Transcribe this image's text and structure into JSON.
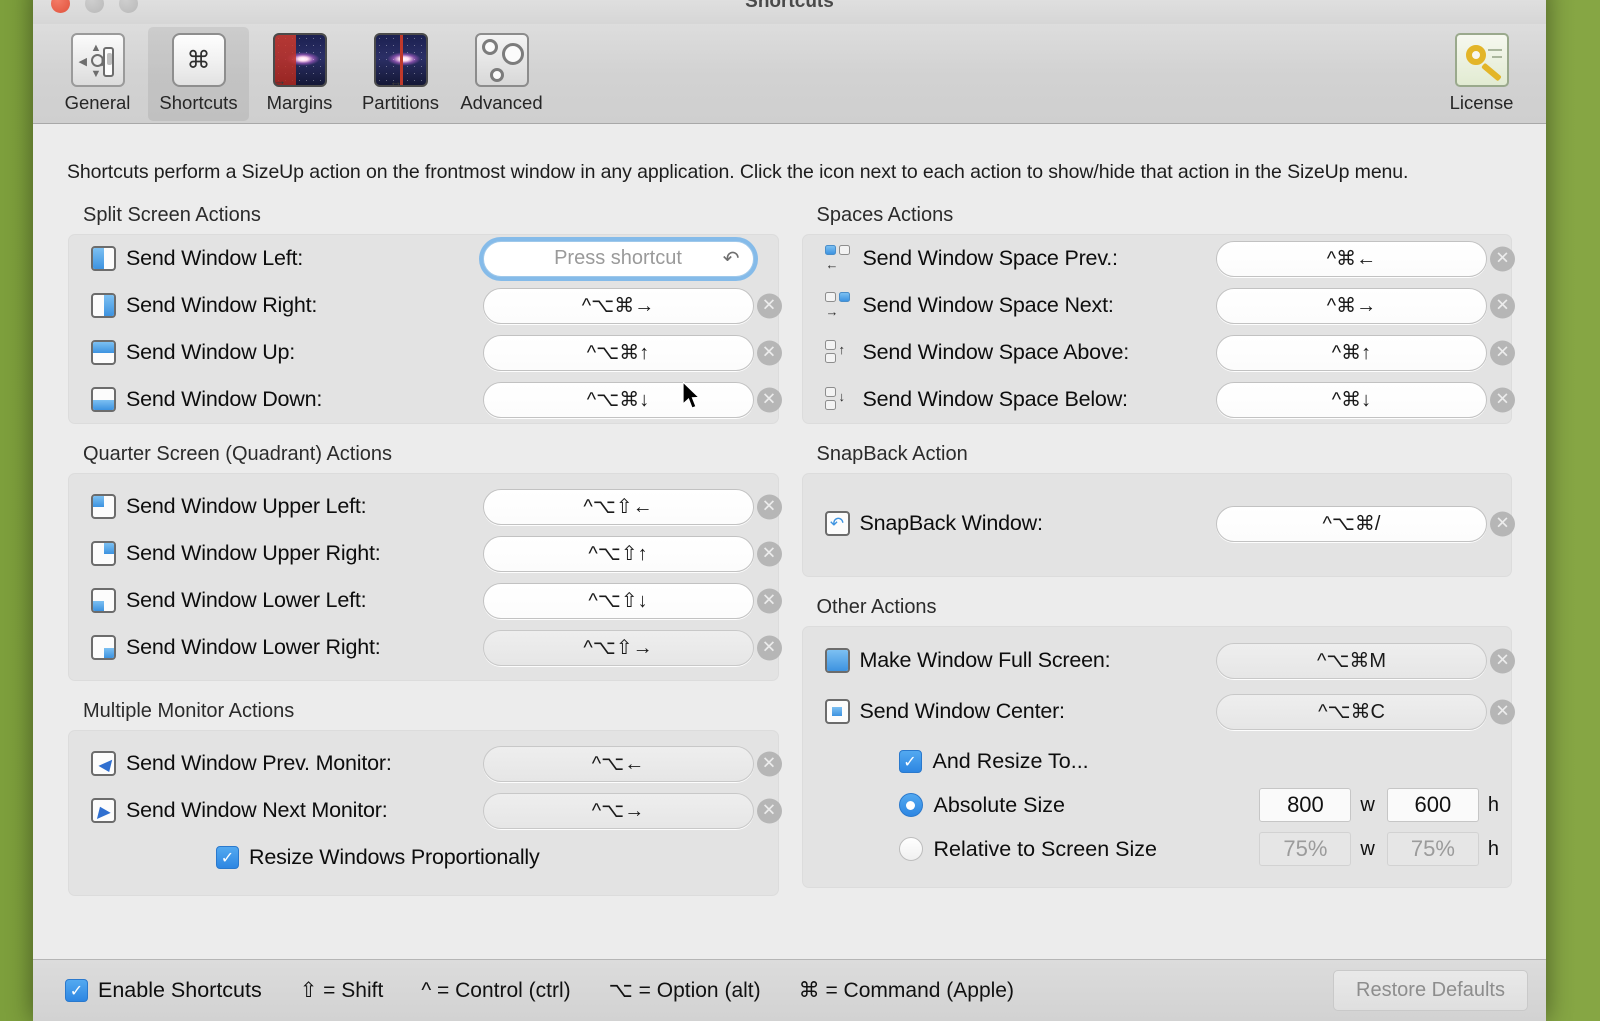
{
  "window": {
    "title": "Shortcuts"
  },
  "toolbar": {
    "items": [
      {
        "label": "General",
        "icon": "general-icon"
      },
      {
        "label": "Shortcuts",
        "icon": "command-icon"
      },
      {
        "label": "Margins",
        "icon": "margins-icon"
      },
      {
        "label": "Partitions",
        "icon": "partitions-icon"
      },
      {
        "label": "Advanced",
        "icon": "gears-icon"
      }
    ],
    "selected": "Shortcuts",
    "license": {
      "label": "License",
      "icon": "key-certificate-icon"
    }
  },
  "intro": "Shortcuts perform a SizeUp action on the frontmost window in any application. Click the icon next to each action to show/hide that action in the SizeUp menu.",
  "groups": {
    "split_screen": {
      "title": "Split Screen Actions",
      "rows": [
        {
          "label": "Send Window Left:",
          "shortcut": "",
          "placeholder": "Press shortcut",
          "focused": true,
          "icon": "half-left-icon"
        },
        {
          "label": "Send Window Right:",
          "shortcut": "^⌥⌘→",
          "focused": false,
          "icon": "half-right-icon"
        },
        {
          "label": "Send Window Up:",
          "shortcut": "^⌥⌘↑",
          "focused": false,
          "icon": "half-top-icon"
        },
        {
          "label": "Send Window Down:",
          "shortcut": "^⌥⌘↓",
          "focused": false,
          "icon": "half-bottom-icon"
        }
      ]
    },
    "quadrant": {
      "title": "Quarter Screen (Quadrant) Actions",
      "rows": [
        {
          "label": "Send Window Upper Left:",
          "shortcut": "^⌥⇧←",
          "icon": "quad-upper-left-icon"
        },
        {
          "label": "Send Window Upper Right:",
          "shortcut": "^⌥⇧↑",
          "icon": "quad-upper-right-icon"
        },
        {
          "label": "Send Window Lower Left:",
          "shortcut": "^⌥⇧↓",
          "icon": "quad-lower-left-icon"
        },
        {
          "label": "Send Window Lower Right:",
          "shortcut": "^⌥⇧→",
          "icon": "quad-lower-right-icon"
        }
      ]
    },
    "multi_monitor": {
      "title": "Multiple Monitor Actions",
      "rows": [
        {
          "label": "Send Window Prev. Monitor:",
          "shortcut": "^⌥←",
          "icon": "monitor-prev-icon"
        },
        {
          "label": "Send Window Next Monitor:",
          "shortcut": "^⌥→",
          "icon": "monitor-next-icon"
        }
      ],
      "checkbox": {
        "label": "Resize Windows Proportionally",
        "checked": true
      }
    },
    "spaces": {
      "title": "Spaces Actions",
      "rows": [
        {
          "label": "Send Window Space Prev.:",
          "shortcut": "^⌘←",
          "icon": "space-prev-icon"
        },
        {
          "label": "Send Window Space Next:",
          "shortcut": "^⌘→",
          "icon": "space-next-icon"
        },
        {
          "label": "Send Window Space Above:",
          "shortcut": "^⌘↑",
          "icon": "space-above-icon"
        },
        {
          "label": "Send Window Space Below:",
          "shortcut": "^⌘↓",
          "icon": "space-below-icon"
        }
      ]
    },
    "snapback": {
      "title": "SnapBack Action",
      "rows": [
        {
          "label": "SnapBack Window:",
          "shortcut": "^⌥⌘/",
          "icon": "snapback-icon"
        }
      ]
    },
    "other": {
      "title": "Other Actions",
      "rows": [
        {
          "label": "Make Window Full Screen:",
          "shortcut": "^⌥⌘M",
          "icon": "full-screen-icon"
        },
        {
          "label": "Send Window Center:",
          "shortcut": "^⌥⌘C",
          "icon": "center-icon"
        }
      ],
      "resize_checkbox": {
        "label": "And Resize To...",
        "checked": true
      },
      "absolute": {
        "label": "Absolute Size",
        "selected": true,
        "width": "800",
        "height": "600",
        "width_unit": "w",
        "height_unit": "h"
      },
      "relative": {
        "label": "Relative to Screen Size",
        "selected": false,
        "width": "75%",
        "height": "75%",
        "width_unit": "w",
        "height_unit": "h"
      }
    }
  },
  "footer": {
    "enable": {
      "label": "Enable Shortcuts",
      "checked": true
    },
    "legend": [
      "⇧ = Shift",
      "^ = Control (ctrl)",
      "⌥ = Option (alt)",
      "⌘ = Command (Apple)"
    ],
    "restore_label": "Restore Defaults"
  },
  "colors": {
    "accent": "#3d93e0",
    "focus_ring": "#6ab0ea",
    "desktop": "#86a644",
    "window_bg": "#ececec",
    "group_bg": "#e3e3e3"
  }
}
